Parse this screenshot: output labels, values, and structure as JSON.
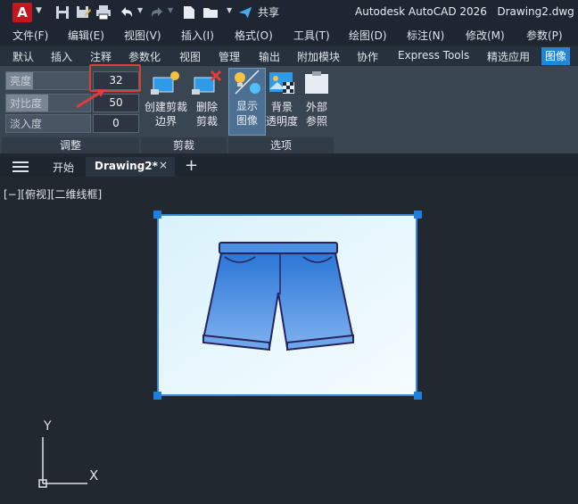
{
  "app": {
    "title": "Autodesk AutoCAD 2026",
    "filename": "Drawing2.dwg",
    "logo_letter": "A",
    "share_label": "共享"
  },
  "menu": [
    "文件(F)",
    "编辑(E)",
    "视图(V)",
    "插入(I)",
    "格式(O)",
    "工具(T)",
    "绘图(D)",
    "标注(N)",
    "修改(M)",
    "参数(P)"
  ],
  "ribbon_tabs": [
    "默认",
    "插入",
    "注释",
    "参数化",
    "视图",
    "管理",
    "输出",
    "附加模块",
    "协作",
    "Express Tools",
    "精选应用",
    "图像"
  ],
  "active_ribbon_tab": "图像",
  "adjust": {
    "brightness_label": "亮度",
    "brightness_value": "32",
    "contrast_label": "对比度",
    "contrast_value": "50",
    "fade_label": "淡入度",
    "fade_value": "0",
    "brightness_fill": 0.32,
    "contrast_fill": 0.5,
    "fade_fill": 0,
    "panel_label": "调整"
  },
  "clip": {
    "create_line1": "创建剪裁",
    "create_line2": "边界",
    "delete_line1": "删除",
    "delete_line2": "剪裁",
    "panel_label": "剪裁"
  },
  "options": {
    "show_line1": "显示",
    "show_line2": "图像",
    "bg_line1": "背景",
    "bg_line2": "透明度",
    "ext_line1": "外部",
    "ext_line2": "参照",
    "panel_label": "选项"
  },
  "doc_tabs": {
    "start": "开始",
    "active": "Drawing2*",
    "close": "×",
    "add": "+"
  },
  "viewport_label": "[−][俯视][二维线框]",
  "ucs": {
    "x": "X",
    "y": "Y"
  },
  "colors": {
    "accent": "#1f87d6",
    "highlight": "#e03c3c",
    "image_frame": "#3f86d6"
  }
}
